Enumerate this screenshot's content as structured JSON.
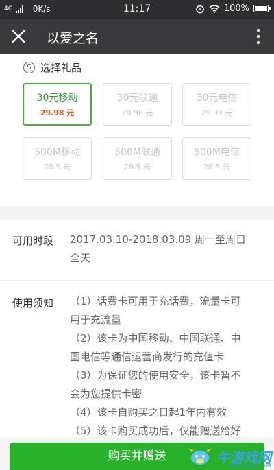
{
  "status_bar": {
    "network": "4G",
    "speed": "0K/s",
    "time": "11:17",
    "battery": "100%",
    "icons": [
      "signal-icon",
      "alarm-icon",
      "wifi-icon",
      "battery-icon"
    ]
  },
  "title_bar": {
    "title": "以爱之名",
    "close_icon": "close-icon",
    "more_icon": "more-icon"
  },
  "gift": {
    "header": "选择礼品",
    "currency_icon": "$",
    "cards": [
      {
        "name": "30元移动",
        "price": "29.98 元",
        "selected": true
      },
      {
        "name": "30元联通",
        "price": "29.98 元",
        "selected": false
      },
      {
        "name": "30元电信",
        "price": "29.98 元",
        "selected": false
      },
      {
        "name": "500M移动",
        "price": "28.5 元",
        "selected": false
      },
      {
        "name": "500M联通",
        "price": "28.5 元",
        "selected": false
      },
      {
        "name": "500M电信",
        "price": "28.5 元",
        "selected": false
      }
    ]
  },
  "availability": {
    "label": "可用时段",
    "lines": [
      "2017.03.10-2018.03.09 周一至周日",
      "全天"
    ]
  },
  "notice": {
    "label": "使用须知",
    "lines": [
      "（1）话费卡可用于充话费，流量卡可",
      "用于充流量",
      "（2）该卡为中国移动、中国联通、中",
      "国电信等通信运营商发行的充值卡",
      "（3）为保证您的使用安全，该卡暂不",
      "会为您提供卡密",
      "（4）该卡自购买之日起1年内有效",
      "（5）该卡购买成功后，仅能赠送给好"
    ]
  },
  "bottom": {
    "buy_label": "购买并赠送"
  },
  "watermark": {
    "text": "牛游戏网",
    "url": "www.newyx.net"
  },
  "colors": {
    "accent_green": "#29b12b",
    "selected_border": "#3fb33f",
    "price_highlight": "#d35a1f",
    "title_bar": "#3a3a3c"
  }
}
